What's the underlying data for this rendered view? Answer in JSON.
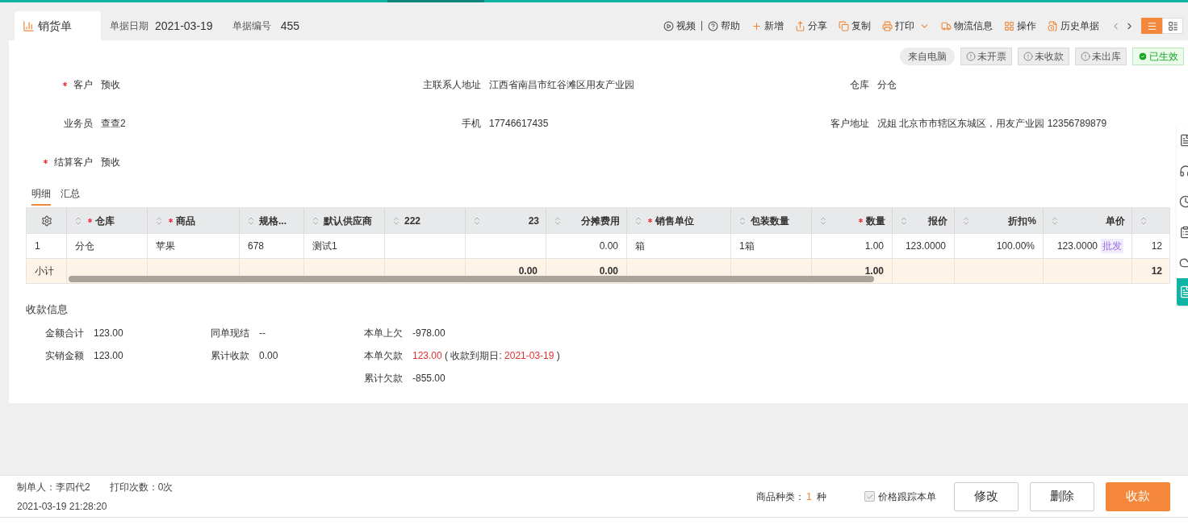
{
  "header": {
    "tab_title": "销货单",
    "date_label": "单据日期",
    "date": "2021-03-19",
    "number_label": "单据编号",
    "number": "455"
  },
  "toolbar": [
    {
      "label": "视频",
      "kind": "play"
    },
    {
      "label": "帮助",
      "kind": "help"
    },
    {
      "label": "新增",
      "kind": "add"
    },
    {
      "label": "分享",
      "kind": "share"
    },
    {
      "label": "复制",
      "kind": "copy"
    },
    {
      "label": "打印",
      "kind": "print"
    },
    {
      "label": "物流信息",
      "kind": "truck"
    },
    {
      "label": "操作",
      "kind": "grid"
    },
    {
      "label": "历史单据",
      "kind": "history"
    }
  ],
  "view_toggle": [
    {
      "kind": "list",
      "selected": true
    },
    {
      "kind": "cards",
      "selected": false
    }
  ],
  "status_tags": [
    {
      "label": "来自电脑",
      "kind": "source"
    },
    {
      "label": "未开票",
      "kind": "pending"
    },
    {
      "label": "未收款",
      "kind": "pending"
    },
    {
      "label": "未出库",
      "kind": "pending"
    },
    {
      "label": "已生效",
      "kind": "done"
    }
  ],
  "fields": [
    {
      "label": "客户",
      "value": "预收",
      "required": true
    },
    {
      "label": "主联系人地址",
      "value": "江西省南昌市红谷滩区用友产业园",
      "required": false
    },
    {
      "label": "仓库",
      "value": "分仓",
      "required": false
    },
    {
      "label": "业务员",
      "value": "查查2",
      "required": false
    },
    {
      "label": "手机",
      "value": "17746617435",
      "required": false
    },
    {
      "label": "客户地址",
      "value": "况姐 北京市市辖区东城区，用友产业园 12356789879",
      "required": false
    },
    {
      "label": "结算客户",
      "value": "预收",
      "required": true
    }
  ],
  "detail_tabs": [
    {
      "label": "明细",
      "selected": true
    },
    {
      "label": "汇总",
      "selected": false
    }
  ],
  "table": {
    "columns": [
      {
        "label": "仓库",
        "required": true
      },
      {
        "label": "商品",
        "required": true
      },
      {
        "label": "规格...",
        "required": false
      },
      {
        "label": "默认供应商",
        "required": false
      },
      {
        "label": "222",
        "required": false
      },
      {
        "label": "23",
        "required": false
      },
      {
        "label": "分摊费用",
        "required": false
      },
      {
        "label": "销售单位",
        "required": true
      },
      {
        "label": "包装数量",
        "required": false
      },
      {
        "label": "数量",
        "required": true
      },
      {
        "label": "报价",
        "required": false
      },
      {
        "label": "折扣%",
        "required": false
      },
      {
        "label": "单价",
        "required": false
      }
    ],
    "rows": [
      {
        "index": "1",
        "cells": [
          "分仓",
          "苹果",
          "678",
          "测试1",
          "",
          "",
          "0.00",
          "箱",
          "1箱",
          "1.00",
          "123.0000",
          "100.00%",
          "123.0000",
          "12"
        ],
        "price_badge": "批发"
      }
    ],
    "subtotal": {
      "label": "小计",
      "cells": [
        "",
        "",
        "",
        "",
        "",
        "0.00",
        "0.00",
        "",
        "",
        "1.00",
        "",
        "",
        "",
        "12"
      ]
    }
  },
  "payment": {
    "title": "收款信息",
    "columns": [
      [
        {
          "label": "金额合计",
          "value": "123.00",
          "kind": "plain"
        },
        {
          "label": "实销金额",
          "value": "123.00",
          "kind": "plain"
        }
      ],
      [
        {
          "label": "同单现结",
          "value": "--",
          "kind": "plain"
        },
        {
          "label": "累计收款",
          "value": "0.00",
          "kind": "plain"
        }
      ],
      [
        {
          "label": "本单上欠",
          "value": "-978.00",
          "kind": "plain"
        },
        {
          "label": "本单欠款",
          "value": "123.00",
          "kind": "due",
          "due_open": "(",
          "due_label": "收款到期日:",
          "due_date": "2021-03-19",
          "due_close": ")"
        },
        {
          "label": "累计欠款",
          "value": "-855.00",
          "kind": "plain"
        }
      ]
    ]
  },
  "footer": {
    "maker": "制单人：李四代2",
    "print_count": "打印次数：0次",
    "time": "2021-03-19 21:28:20",
    "kinds_label": "商品种类：",
    "kinds_count": "1",
    "kinds_unit": "种",
    "track_label": "价格跟踪本单",
    "track_checked": true,
    "buttons": [
      {
        "label": "修改",
        "kind": "outline"
      },
      {
        "label": "删除",
        "kind": "outline"
      },
      {
        "label": "收款",
        "kind": "primary"
      }
    ]
  }
}
